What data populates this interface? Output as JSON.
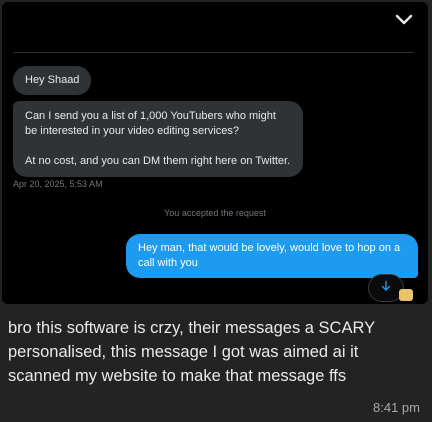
{
  "conversation": {
    "incoming_greeting": "Hey Shaad",
    "incoming_message_line1": "Can I send you a list of 1,000 YouTubers who might be interested in your video editing services?",
    "incoming_message_line2": "At no cost, and you can DM them right here on Twitter.",
    "timestamp": "Apr 20, 2025, 5:53 AM",
    "system_note": "You accepted the request",
    "outgoing_message": "Hey man, that would be lovely, would love to hop on a call with you"
  },
  "caption": {
    "text": "bro this software is crzy, their messages a SCARY personalised, this message I got was aimed ai it scanned my website to make that message ffs",
    "time": "8:41 pm"
  },
  "icons": {
    "collapse": "chevron-down-icon",
    "scroll_down": "arrow-down-icon"
  },
  "colors": {
    "outgoing_bubble": "#1d9bf0",
    "incoming_bubble": "#2f3336",
    "background": "#000000"
  }
}
